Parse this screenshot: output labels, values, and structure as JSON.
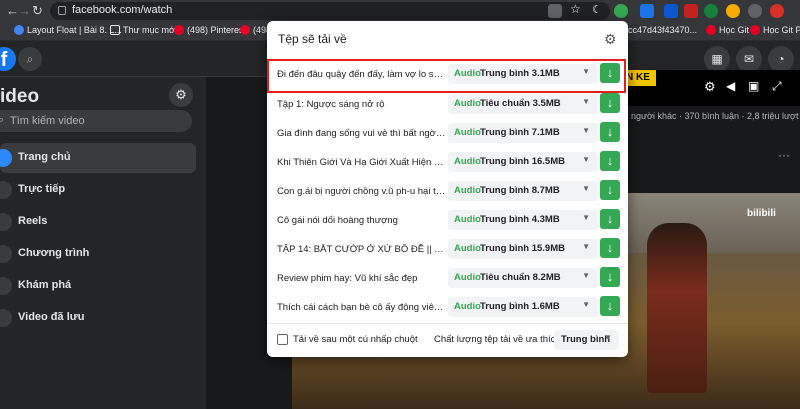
{
  "browser": {
    "url": "facebook.com/watch",
    "back_icon": "←",
    "forward_icon": "→",
    "reload_icon": "↻",
    "right_tabs": [
      "cc47d43f43470...",
      "Học Git",
      "Học Git Phâ"
    ],
    "bookmarks": [
      {
        "label": "Layout Float | Bài 8. L...",
        "color": "#4285f4"
      },
      {
        "label": "Thư mục mới",
        "color": "#e8eaed"
      },
      {
        "label": "(498) Pinterest",
        "color": "#e60023"
      },
      {
        "label": "(498) Pinterest",
        "color": "#e60023"
      },
      {
        "label": "(49",
        "color": "#e60023"
      }
    ]
  },
  "sidebar": {
    "title": "ideo",
    "search_placeholder": "Tìm kiếm video",
    "items": [
      {
        "label": "Trang chủ",
        "active": true
      },
      {
        "label": "Trực tiếp",
        "active": false
      },
      {
        "label": "Reels",
        "active": false
      },
      {
        "label": "Chương trình",
        "active": false
      },
      {
        "label": "Khám phá",
        "active": false
      },
      {
        "label": "Video đã lưu",
        "active": false
      }
    ]
  },
  "video": {
    "banner": "N KE",
    "meta": "người khác · 370 bình luận · 2,8 triệu lượt xem",
    "watermark": "bilibili"
  },
  "popup": {
    "title": "Tệp sẽ tải về",
    "rows": [
      {
        "name": "Đi đến đâu quậy đến đấy, làm vợ lo sốt vó",
        "type": "Audio",
        "quality": "Trung bình",
        "size": "3.1MB",
        "highlight": true
      },
      {
        "name": "Tập 1: Ngược sáng nở rộ",
        "type": "Audio",
        "quality": "Tiêu chuẩn",
        "size": "3.5MB",
        "highlight": false
      },
      {
        "name": "Gia đình đang sống vui vẻ thì bất ngờ b...",
        "type": "Audio",
        "quality": "Trung bình",
        "size": "7.1MB",
        "highlight": false
      },
      {
        "name": "Khi Thiên Giới Và Hạ Giới Xuất Hiện Một...",
        "type": "Audio",
        "quality": "Trung bình",
        "size": "16.5MB",
        "highlight": false
      },
      {
        "name": "Con g.ái bị người chồng v.ũ ph-u hại th...",
        "type": "Audio",
        "quality": "Trung bình",
        "size": "8.7MB",
        "highlight": false
      },
      {
        "name": "Cô gái nói dối hoàng thượng",
        "type": "Audio",
        "quality": "Trung bình",
        "size": "4.3MB",
        "highlight": false
      },
      {
        "name": "TẬP 14: BẮT CƯỚP Ở XỨ BỒ ĐỀ || TÂY D...",
        "type": "Audio",
        "quality": "Trung bình",
        "size": "15.9MB",
        "highlight": false
      },
      {
        "name": "Review phim hay: Vũ khí sắc đẹp",
        "type": "Audio",
        "quality": "Tiêu chuẩn",
        "size": "8.2MB",
        "highlight": false
      },
      {
        "name": "Thích cái cách bạn bè cô ấy động viên c...",
        "type": "Audio",
        "quality": "Trung bình",
        "size": "1.6MB",
        "highlight": false
      }
    ],
    "footer_checkbox_label": "Tải về sau một cú nhấp chuột",
    "footer_pref_label": "Chất lượng tệp tải về ưa thích",
    "footer_pref_value": "Trung bình"
  }
}
